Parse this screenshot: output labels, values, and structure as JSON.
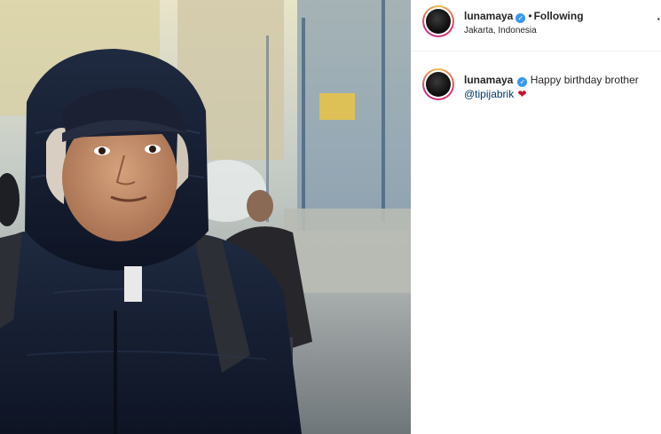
{
  "post": {
    "username": "lunamaya",
    "follow_status": "Following",
    "location": "Jakarta, Indonesia",
    "more_options_icon": "more-options-icon"
  },
  "caption": {
    "username": "lunamaya",
    "text": "Happy birthday brother",
    "mention": "@tipijabrik",
    "emoji": "❤"
  },
  "colors": {
    "verified": "#3897f0",
    "mention": "#00376b",
    "heart": "#c0122a"
  }
}
